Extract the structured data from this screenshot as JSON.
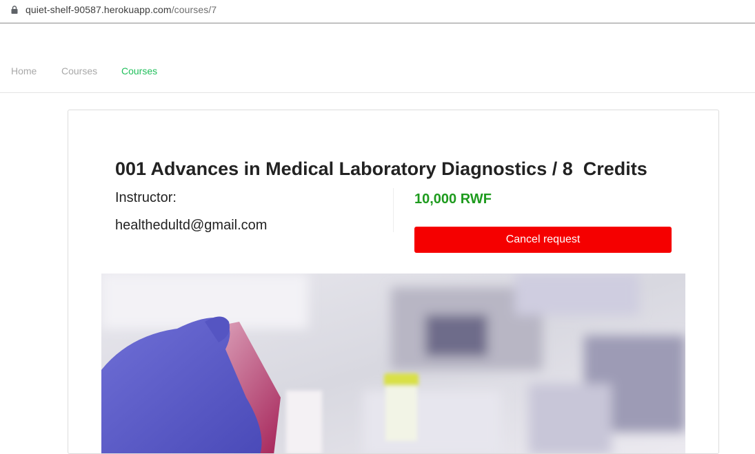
{
  "browser": {
    "url_host": "quiet-shelf-90587.herokuapp.com",
    "url_path": "/courses/7",
    "lock_icon": "lock-icon"
  },
  "nav": {
    "items": [
      {
        "label": "Home",
        "active": false
      },
      {
        "label": "Courses",
        "active": false
      },
      {
        "label": "Courses",
        "active": true
      }
    ],
    "active_color": "#1fbf5a"
  },
  "course": {
    "title": "001 Advances in Medical Laboratory Diagnostics / 8  Credits",
    "instructor_label": "Instructor:",
    "instructor_email": "healthedultd@gmail.com",
    "price": "10,000 RWF",
    "price_color": "#1e9b1e",
    "cancel_label": "Cancel request",
    "cancel_color": "#f50000",
    "image": "lab-test-tube-photo"
  }
}
